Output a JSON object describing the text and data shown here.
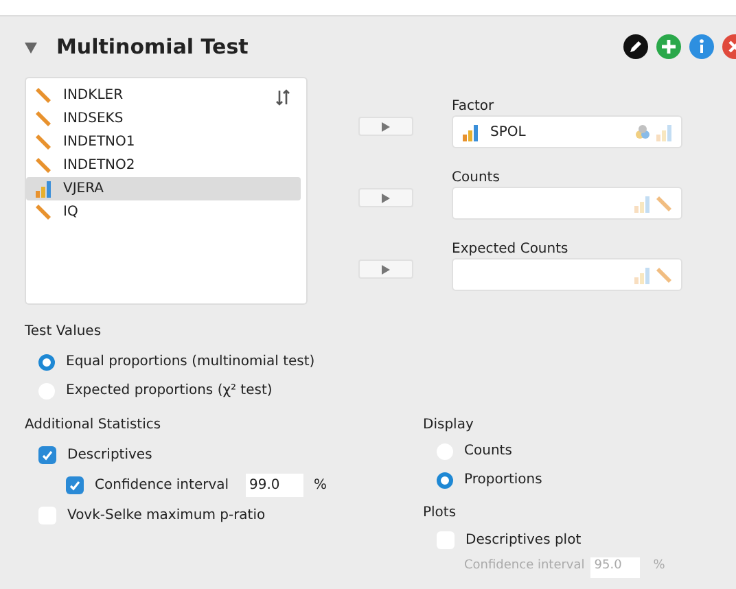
{
  "title": "Multinomial Test",
  "expanded": true,
  "variables": [
    {
      "name": "INDKLER",
      "kind": "scale",
      "selected": false
    },
    {
      "name": "INDSEKS",
      "kind": "scale",
      "selected": false
    },
    {
      "name": "INDETNO1",
      "kind": "scale",
      "selected": false
    },
    {
      "name": "INDETNO2",
      "kind": "scale",
      "selected": false
    },
    {
      "name": "VJERA",
      "kind": "ordinal",
      "selected": true
    },
    {
      "name": "IQ",
      "kind": "scale",
      "selected": false
    }
  ],
  "targets": [
    {
      "label": "Factor",
      "items": [
        {
          "name": "SPOL",
          "kind": "ordinal"
        }
      ]
    },
    {
      "label": "Counts"
    },
    {
      "label": "Expected Counts"
    }
  ],
  "test_values": {
    "title": "Test Values",
    "options": [
      {
        "label": "Equal proportions (multinomial test)",
        "selected": true
      },
      {
        "label": "Expected proportions (χ² test)",
        "selected": false
      }
    ]
  },
  "additional_statistics": {
    "title": "Additional Statistics",
    "items": [
      {
        "label": "Descriptives",
        "checked": true,
        "kind": "option"
      },
      {
        "label": "Confidence interval",
        "checked": true,
        "kind": "suboption",
        "value": "99.0",
        "unit": "%"
      },
      {
        "label": "Vovk-Selke maximum p-ratio",
        "checked": false,
        "kind": "option"
      }
    ]
  },
  "display": {
    "title": "Display",
    "options": [
      {
        "label": "Counts",
        "selected": false
      },
      {
        "label": "Proportions",
        "selected": true
      }
    ]
  },
  "plots": {
    "title": "Plots",
    "checked": false,
    "label": "Descriptives plot",
    "ci_label": "Confidence interval",
    "ci_value": "95.0",
    "ci_unit": "%"
  }
}
